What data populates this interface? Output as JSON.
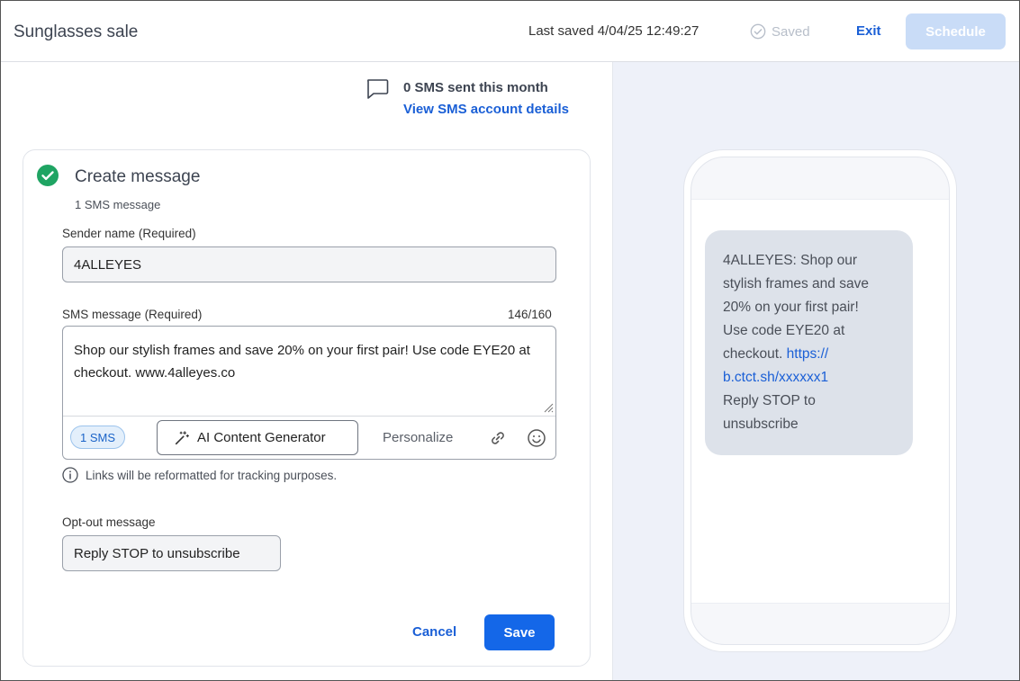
{
  "header": {
    "title": "Sunglasses sale",
    "last_saved": "Last saved 4/04/25 12:49:27",
    "saved_label": "Saved",
    "exit_label": "Exit",
    "schedule_label": "Schedule"
  },
  "sms_account": {
    "count_text": "0 SMS sent this month",
    "details_link": "View SMS account details"
  },
  "card": {
    "title": "Create message",
    "subtitle": "1 SMS message",
    "sender_label": "Sender name",
    "sender_required": "(Required)",
    "sender_value": "4ALLEYES",
    "message_label": "SMS message",
    "message_required": "(Required)",
    "counter": "146/160",
    "message_value": "Shop our stylish frames and save 20% on your first pair! Use code EYE20 at checkout. www.4alleyes.co",
    "sms_pill": "1 SMS",
    "ai_button": "AI Content Generator",
    "personalize": "Personalize",
    "note": "Links will be reformatted for tracking purposes.",
    "optout_label": "Opt-out message",
    "optout_value": "Reply STOP to unsubscribe",
    "cancel_label": "Cancel",
    "save_label": "Save"
  },
  "preview": {
    "line1": "4ALLEYES: Shop our",
    "line2": "stylish frames and save",
    "line3": "20% on your first pair!",
    "line4": "Use code EYE20 at",
    "line5_prefix": "checkout. ",
    "link_part1": "https://",
    "link_part2": "b.ctct.sh/xxxxxx1",
    "line7": "Reply STOP to",
    "line8": "unsubscribe"
  },
  "colors": {
    "accent": "#1467e8",
    "link": "#1a5fd6",
    "success": "#1fa463",
    "schedule_disabled": "#c9dcf7"
  },
  "icons": [
    "check-circle-icon",
    "chat-icon",
    "magic-wand-icon",
    "link-icon",
    "emoji-icon",
    "info-icon",
    "saved-check-icon"
  ]
}
